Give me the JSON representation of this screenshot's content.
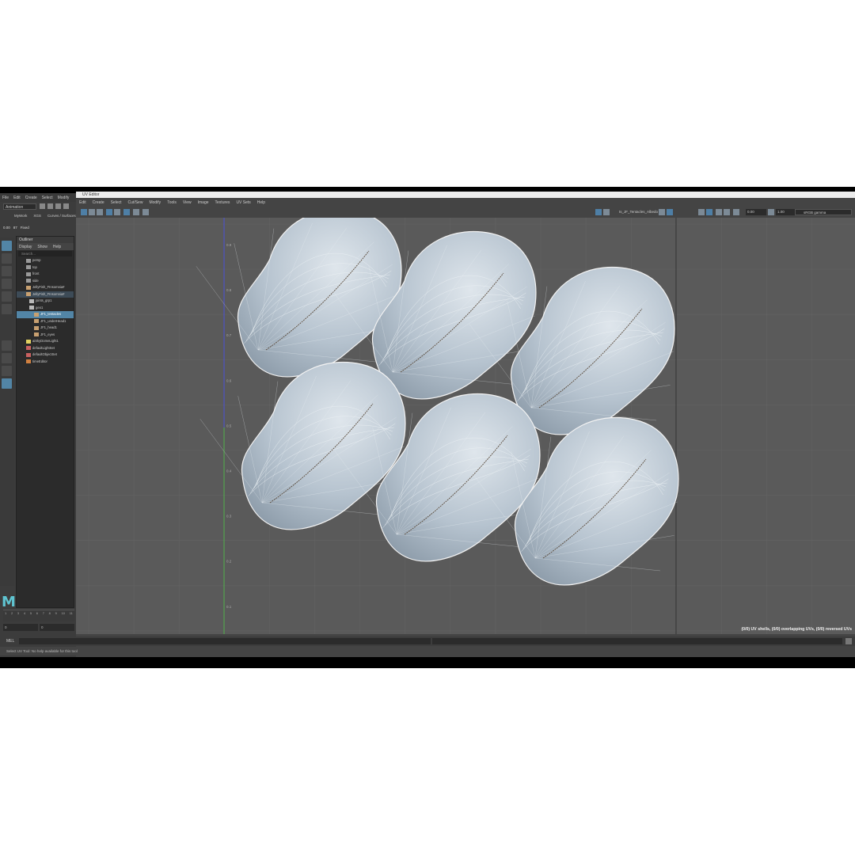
{
  "maya": {
    "menu": [
      "File",
      "Edit",
      "Create",
      "Select",
      "Modify"
    ],
    "mode": "Animation",
    "shelf_tabs": [
      "MyWork",
      "XGS",
      "Curves / Surfaces"
    ],
    "status": {
      "field_a": "0.00",
      "field_b": "87",
      "field_c": "Fixed"
    }
  },
  "outliner": {
    "title": "Outliner",
    "menu": [
      "Display",
      "Show",
      "Help"
    ],
    "search_placeholder": "Search...",
    "items": [
      {
        "label": "persp",
        "icon": "camera-icon",
        "state": "normal"
      },
      {
        "label": "top",
        "icon": "camera-icon",
        "state": "normal"
      },
      {
        "label": "front",
        "icon": "camera-icon",
        "state": "normal"
      },
      {
        "label": "side",
        "icon": "camera-icon",
        "state": "normal"
      },
      {
        "label": "JellyFish_FInsomnia#",
        "icon": "mesh-icon",
        "state": "normal"
      },
      {
        "label": "JellyFish_FInsomnia#",
        "icon": "mesh-icon",
        "state": "highlight"
      },
      {
        "label": "joints_grp1",
        "icon": "group-icon",
        "state": "normal"
      },
      {
        "label": "geo1",
        "icon": "group-icon",
        "state": "normal"
      },
      {
        "label": "JF1_tentacles",
        "icon": "mesh-icon",
        "state": "selected"
      },
      {
        "label": "JF1_underHead1",
        "icon": "mesh-icon",
        "state": "normal"
      },
      {
        "label": "JF1_head1",
        "icon": "mesh-icon",
        "state": "normal"
      },
      {
        "label": "JF1_eyes",
        "icon": "mesh-icon",
        "state": "normal"
      },
      {
        "label": "aiSkyDomeLight1",
        "icon": "light-icon",
        "state": "normal"
      },
      {
        "label": "defaultLightSet",
        "icon": "set-icon",
        "state": "normal"
      },
      {
        "label": "defaultObjectSet",
        "icon": "set-icon",
        "state": "normal"
      },
      {
        "label": "timeEditor",
        "icon": "editor-icon",
        "state": "normal"
      }
    ]
  },
  "timeline": {
    "ticks": [
      "1",
      "2",
      "3",
      "4",
      "5",
      "6",
      "7",
      "8",
      "9",
      "10",
      "11"
    ],
    "start": "0",
    "end": "0"
  },
  "uv_editor": {
    "title": "UV Editor",
    "menu": [
      "Edit",
      "Create",
      "Select",
      "Cut/Sew",
      "Modify",
      "Tools",
      "View",
      "Image",
      "Textures",
      "UV Sets",
      "Help"
    ],
    "texture_name": "ts_JF_Tentacles_Albedo",
    "exposure": "0.00",
    "gamma": "1.00",
    "view_transform": "sRGB gamma",
    "v_ticks": [
      "0.9",
      "0.8",
      "0.7",
      "0.6",
      "0.5",
      "0.4",
      "0.3",
      "0.2",
      "0.1"
    ],
    "status": "(0/0) UV shells, (0/0) overlapping UVs, (0/0) reversed UVs",
    "shell_count": 6
  },
  "command": {
    "label": "MEL",
    "help": "Select UV Tool: No help available for this tool"
  },
  "colors": {
    "accent": "#5285a6",
    "viewport": "#5a5a5a",
    "panel": "#444444",
    "axis_v": "#4fb04a",
    "axis_u": "#4a4fd8"
  }
}
